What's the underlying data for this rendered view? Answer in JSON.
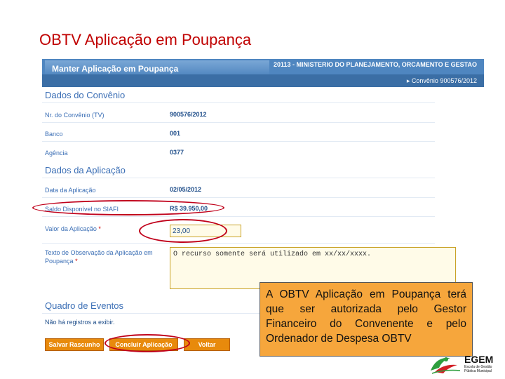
{
  "slide": {
    "title": "OBTV Aplicação em Poupança",
    "note": "A OBTV Aplicação em Poupança terá que ser autorizada pelo Gestor Financeiro do Convenente e pelo Ordenador de Despesa OBTV"
  },
  "header": {
    "tab_title": "Manter Aplicação em Poupança",
    "ministry": "20113 - MINISTERIO DO PLANEJAMENTO, ORCAMENTO E GESTAO",
    "convenio_crumb": "Convênio 900576/2012"
  },
  "convenio": {
    "section_title": "Dados do Convênio",
    "nr_label": "Nr. do Convênio (TV)",
    "nr_value": "900576/2012",
    "banco_label": "Banco",
    "banco_value": "001",
    "agencia_label": "Agência",
    "agencia_value": "0377"
  },
  "aplicacao": {
    "section_title": "Dados da Aplicação",
    "data_label": "Data da Aplicação",
    "data_value": "02/05/2012",
    "saldo_label": "Saldo Disponível no SIAFI",
    "saldo_value": "R$ 39.950,00",
    "valor_label": "Valor da Aplicação",
    "valor_value": "23,00",
    "obs_label": "Texto de Observação da Aplicação em Poupança",
    "obs_value": "O recurso somente será utilizado em xx/xx/xxxx.",
    "required_mark": "*"
  },
  "eventos": {
    "section_title": "Quadro de Eventos",
    "empty_text": "Não há registros a exibir."
  },
  "buttons": {
    "salvar": "Salvar Rascunho",
    "concluir": "Concluir Aplicação",
    "voltar": "Voltar"
  },
  "logo": {
    "name": "EGEM",
    "subtitle": "Escola de Gestão Pública Municipal"
  },
  "colors": {
    "title": "#c00000",
    "header_blue": "#4f86c0",
    "label_blue": "#3a6eb5",
    "button_orange": "#e88a0c",
    "note_orange": "#f6a63c",
    "highlight_red": "#c0001a"
  }
}
